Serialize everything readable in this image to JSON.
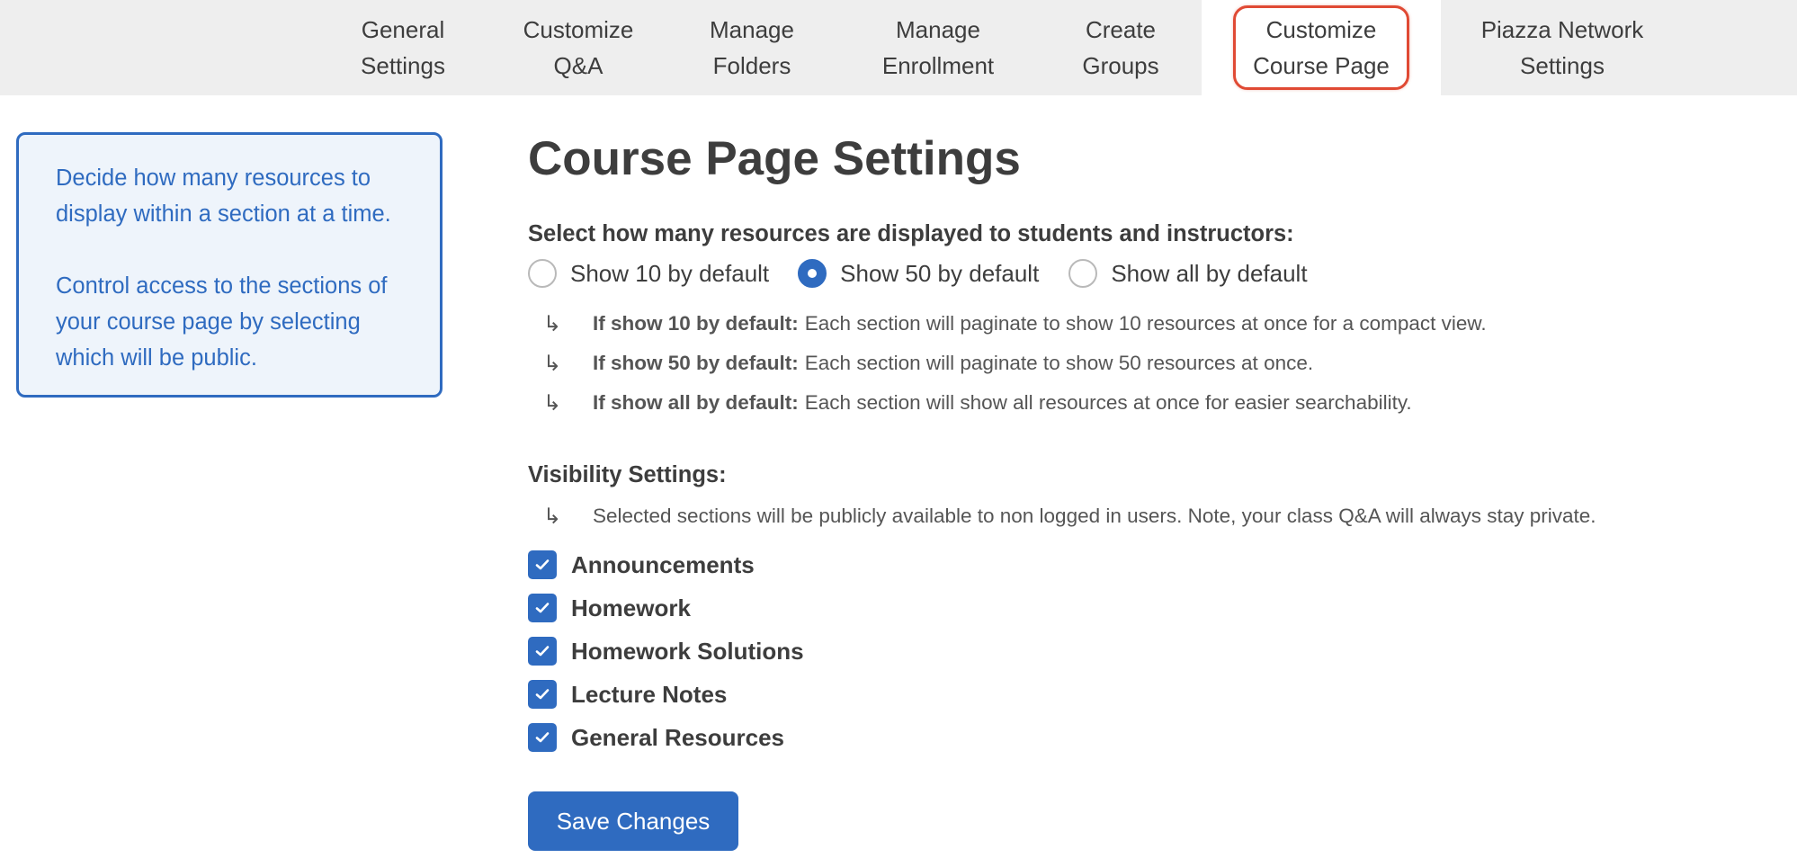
{
  "tabs": [
    {
      "label": "General\nSettings",
      "active": false
    },
    {
      "label": "Customize\nQ&A",
      "active": false
    },
    {
      "label": "Manage\nFolders",
      "active": false
    },
    {
      "label": "Manage\nEnrollment",
      "active": false
    },
    {
      "label": "Create\nGroups",
      "active": false
    },
    {
      "label": "Customize\nCourse Page",
      "active": true
    },
    {
      "label": "Piazza Network\nSettings",
      "active": false
    }
  ],
  "info": {
    "paragraph1": "Decide how many resources to display within a section at a time.",
    "paragraph2": "Control access to the sections of your course page by selecting which will be public."
  },
  "main": {
    "title": "Course Page Settings",
    "select_label": "Select how many resources are displayed to students and instructors:",
    "radio_options": [
      {
        "label": "Show 10 by default",
        "checked": false
      },
      {
        "label": "Show 50 by default",
        "checked": true
      },
      {
        "label": "Show all by default",
        "checked": false
      }
    ],
    "notes": [
      {
        "bold": "If show 10 by default:",
        "text": "Each section will paginate to show 10 resources at once for a compact view."
      },
      {
        "bold": "If show 50 by default:",
        "text": "Each section will paginate to show 50 resources at once."
      },
      {
        "bold": "If show all by default:",
        "text": "Each section will show all resources at once for easier searchability."
      }
    ],
    "arrow_glyph": "↳",
    "visibility_label": "Visibility Settings:",
    "visibility_note": "Selected sections will be publicly available to non logged in users. Note, your class Q&A will always stay private.",
    "sections": [
      {
        "label": "Announcements",
        "checked": true
      },
      {
        "label": "Homework",
        "checked": true
      },
      {
        "label": "Homework Solutions",
        "checked": true
      },
      {
        "label": "Lecture Notes",
        "checked": true
      },
      {
        "label": "General Resources",
        "checked": true
      }
    ],
    "save_label": "Save Changes"
  },
  "colors": {
    "accent": "#2f6bc0",
    "highlight": "#e04a34",
    "tabbar_bg": "#eeeeee",
    "info_bg": "#eef4fb"
  }
}
